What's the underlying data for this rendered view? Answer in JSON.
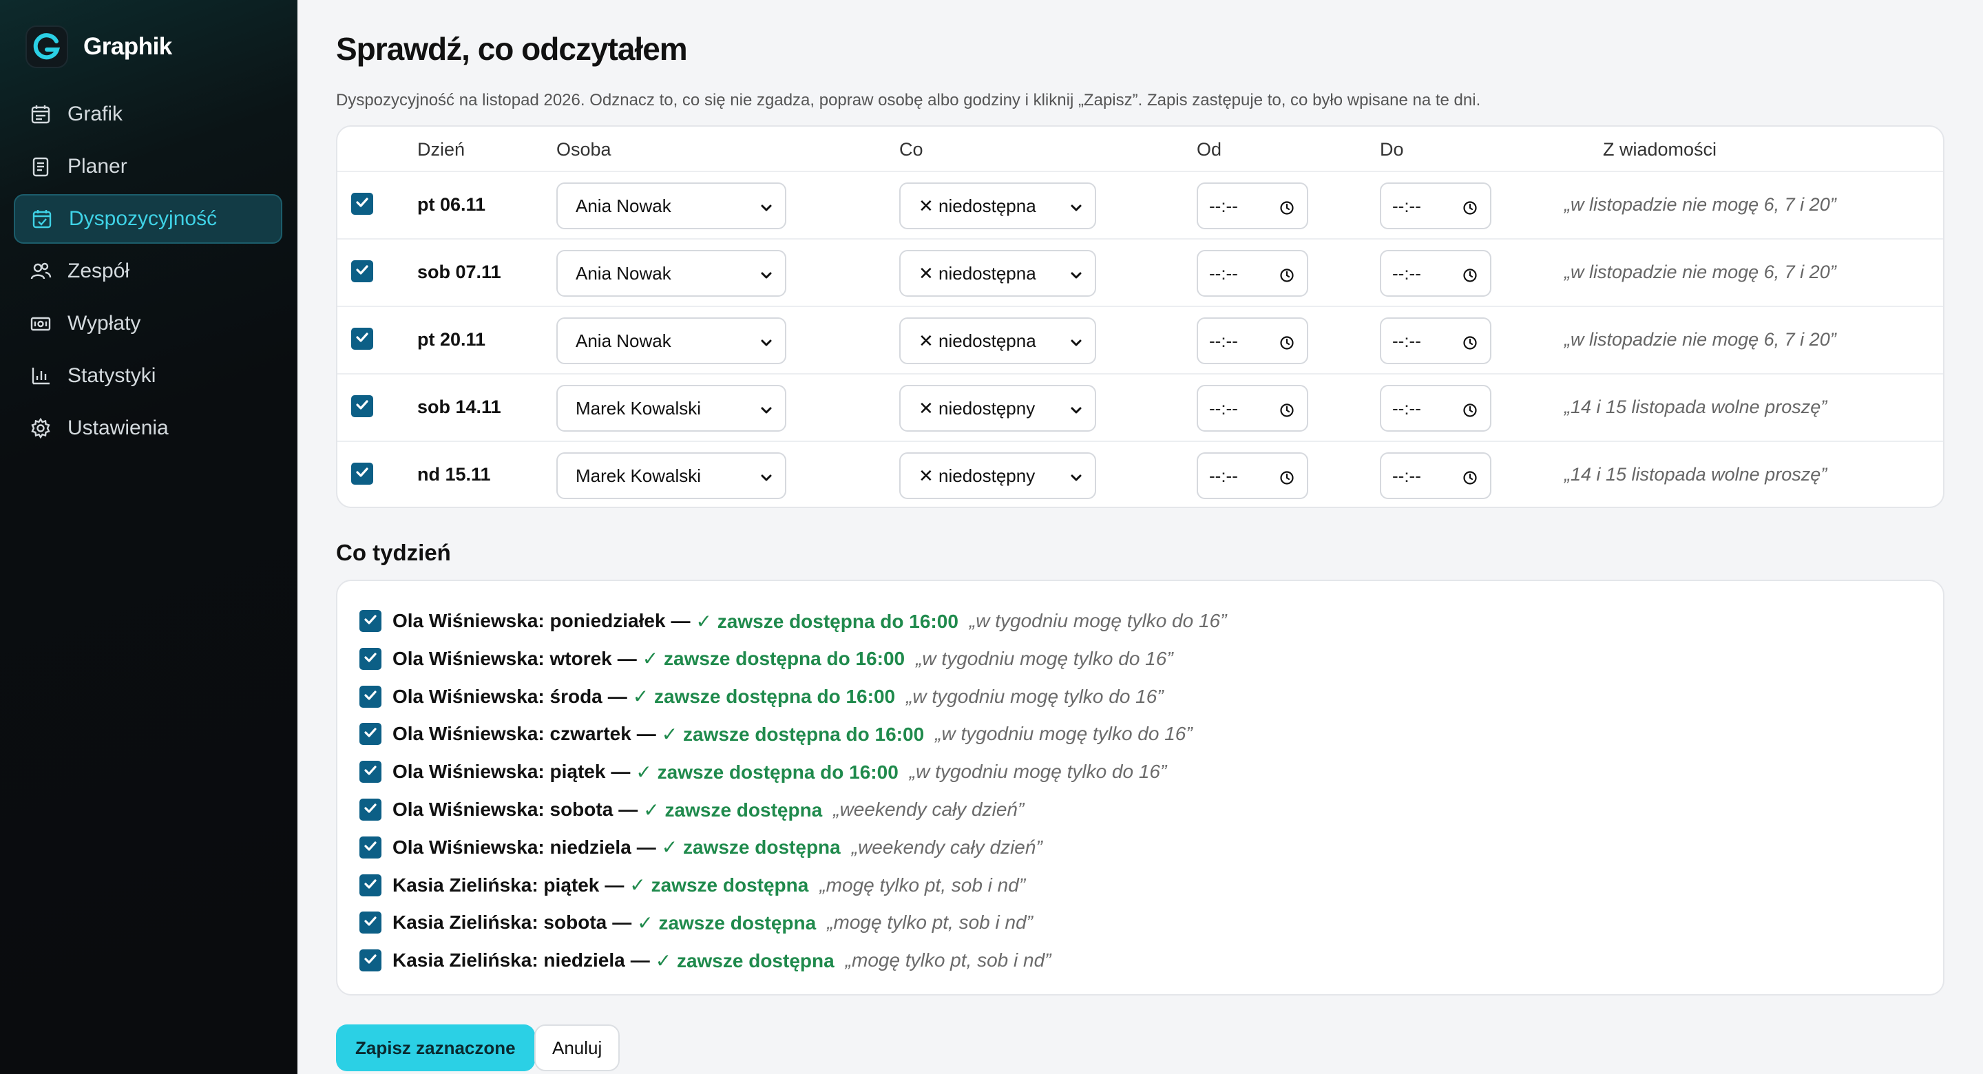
{
  "app": {
    "name": "Graphik"
  },
  "sidebar": {
    "items": [
      {
        "label": "Grafik",
        "icon": "calendar-grid-icon"
      },
      {
        "label": "Planer",
        "icon": "clipboard-icon"
      },
      {
        "label": "Dyspozycyjność",
        "icon": "calendar-check-icon",
        "active": true
      },
      {
        "label": "Zespół",
        "icon": "users-icon"
      },
      {
        "label": "Wypłaty",
        "icon": "banknote-icon"
      },
      {
        "label": "Statystyki",
        "icon": "bar-chart-icon"
      },
      {
        "label": "Ustawienia",
        "icon": "gear-icon"
      }
    ]
  },
  "page": {
    "title": "Sprawdź, co odczytałem",
    "description": "Dyspozycyjność na listopad 2026. Odznacz to, co się nie zgadza, popraw osobę albo godziny i kliknij „Zapisz”. Zapis zastępuje to, co było wpisane na te dni."
  },
  "table": {
    "headers": {
      "day": "Dzień",
      "person": "Osoba",
      "what": "Co",
      "from": "Od",
      "to": "Do",
      "message": "Z wiadomości"
    },
    "time_placeholder": "--:--",
    "rows": [
      {
        "checked": true,
        "day": "pt 06.11",
        "person": "Ania Nowak",
        "what": "✕ niedostępna",
        "from": "--:--",
        "to": "--:--",
        "message": "„w listopadzie nie mogę 6, 7 i 20”"
      },
      {
        "checked": true,
        "day": "sob 07.11",
        "person": "Ania Nowak",
        "what": "✕ niedostępna",
        "from": "--:--",
        "to": "--:--",
        "message": "„w listopadzie nie mogę 6, 7 i 20”"
      },
      {
        "checked": true,
        "day": "pt 20.11",
        "person": "Ania Nowak",
        "what": "✕ niedostępna",
        "from": "--:--",
        "to": "--:--",
        "message": "„w listopadzie nie mogę 6, 7 i 20”"
      },
      {
        "checked": true,
        "day": "sob 14.11",
        "person": "Marek Kowalski",
        "what": "✕ niedostępny",
        "from": "--:--",
        "to": "--:--",
        "message": "„14 i 15 listopada wolne proszę”"
      },
      {
        "checked": true,
        "day": "nd 15.11",
        "person": "Marek Kowalski",
        "what": "✕ niedostępny",
        "from": "--:--",
        "to": "--:--",
        "message": "„14 i 15 listopada wolne proszę”"
      }
    ]
  },
  "weekly": {
    "title": "Co tydzień",
    "rows": [
      {
        "checked": true,
        "label": "Ola Wiśniewska: poniedziałek",
        "status": "✓ zawsze dostępna do 16:00",
        "quote": "„w tygodniu mogę tylko do 16”"
      },
      {
        "checked": true,
        "label": "Ola Wiśniewska: wtorek",
        "status": "✓ zawsze dostępna do 16:00",
        "quote": "„w tygodniu mogę tylko do 16”"
      },
      {
        "checked": true,
        "label": "Ola Wiśniewska: środa",
        "status": "✓ zawsze dostępna do 16:00",
        "quote": "„w tygodniu mogę tylko do 16”"
      },
      {
        "checked": true,
        "label": "Ola Wiśniewska: czwartek",
        "status": "✓ zawsze dostępna do 16:00",
        "quote": "„w tygodniu mogę tylko do 16”"
      },
      {
        "checked": true,
        "label": "Ola Wiśniewska: piątek",
        "status": "✓ zawsze dostępna do 16:00",
        "quote": "„w tygodniu mogę tylko do 16”"
      },
      {
        "checked": true,
        "label": "Ola Wiśniewska: sobota",
        "status": "✓ zawsze dostępna",
        "quote": "„weekendy cały dzień”"
      },
      {
        "checked": true,
        "label": "Ola Wiśniewska: niedziela",
        "status": "✓ zawsze dostępna",
        "quote": "„weekendy cały dzień”"
      },
      {
        "checked": true,
        "label": "Kasia Zielińska: piątek",
        "status": "✓ zawsze dostępna",
        "quote": "„mogę tylko pt, sob i nd”"
      },
      {
        "checked": true,
        "label": "Kasia Zielińska: sobota",
        "status": "✓ zawsze dostępna",
        "quote": "„mogę tylko pt, sob i nd”"
      },
      {
        "checked": true,
        "label": "Kasia Zielińska: niedziela",
        "status": "✓ zawsze dostępna",
        "quote": "„mogę tylko pt, sob i nd”"
      }
    ]
  },
  "actions": {
    "save_label": "Zapisz zaznaczone",
    "cancel_label": "Anuluj"
  },
  "colors": {
    "accent": "#2bd0e5",
    "checkbox": "#0c5f86",
    "success": "#1f8a4c",
    "sidebar_bg": "#0a0c0e",
    "active_nav_text": "#3fd2e6"
  }
}
